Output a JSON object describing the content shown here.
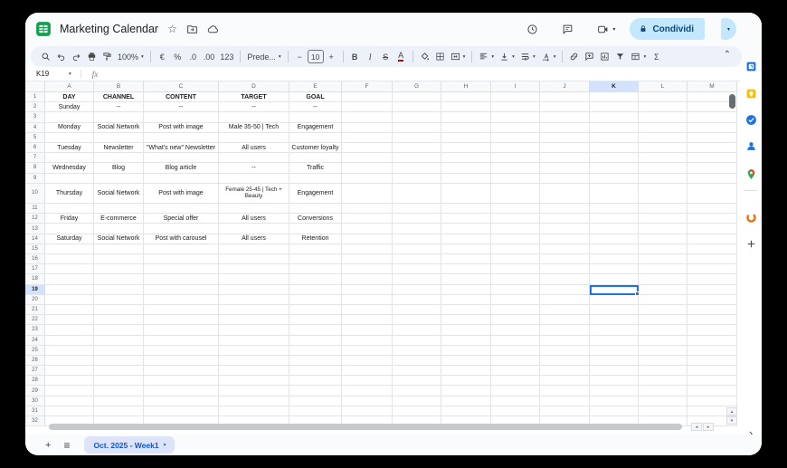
{
  "titlebar": {
    "title": "Marketing Calendar",
    "share_label": "Condividi",
    "icons": [
      "star-icon",
      "move-folder-icon",
      "cloud-status-icon",
      "history-icon",
      "comments-icon",
      "meet-icon",
      "lock-icon"
    ]
  },
  "toolbar": {
    "items": [
      {
        "name": "search",
        "type": "icon",
        "icon": "search"
      },
      {
        "name": "undo",
        "type": "icon",
        "icon": "undo"
      },
      {
        "name": "redo",
        "type": "icon",
        "icon": "redo"
      },
      {
        "name": "print",
        "type": "icon",
        "icon": "print"
      },
      {
        "name": "paint-format",
        "type": "icon",
        "icon": "paint"
      },
      {
        "name": "zoom",
        "type": "select",
        "label": "100%"
      },
      {
        "name": "sep1",
        "type": "sep"
      },
      {
        "name": "format-currency",
        "type": "text",
        "label": "€"
      },
      {
        "name": "format-percent",
        "type": "text",
        "label": "%"
      },
      {
        "name": "decrease-decimals",
        "type": "text",
        "label": ".0"
      },
      {
        "name": "increase-decimals",
        "type": "text",
        "label": ".00"
      },
      {
        "name": "more-formats",
        "type": "text",
        "label": "123"
      },
      {
        "name": "sep2",
        "type": "sep"
      },
      {
        "name": "font",
        "type": "select",
        "label": "Prede..."
      },
      {
        "name": "sep3",
        "type": "sep"
      },
      {
        "name": "font-size-decrease",
        "type": "text",
        "label": "−"
      },
      {
        "name": "font-size",
        "type": "input",
        "label": "10"
      },
      {
        "name": "font-size-increase",
        "type": "text",
        "label": "+"
      },
      {
        "name": "sep4",
        "type": "sep"
      },
      {
        "name": "bold",
        "type": "text",
        "label": "B",
        "cls": "b"
      },
      {
        "name": "italic",
        "type": "text",
        "label": "I",
        "cls": "i"
      },
      {
        "name": "strikethrough",
        "type": "text",
        "label": "S",
        "cls": "s"
      },
      {
        "name": "text-color",
        "type": "text",
        "label": "A",
        "cls": "u"
      },
      {
        "name": "sep5",
        "type": "sep"
      },
      {
        "name": "fill-color",
        "type": "icon",
        "icon": "fill"
      },
      {
        "name": "borders",
        "type": "icon",
        "icon": "borders"
      },
      {
        "name": "merge-cells",
        "type": "select-icon",
        "icon": "merge"
      },
      {
        "name": "sep6",
        "type": "sep"
      },
      {
        "name": "horizontal-align",
        "type": "select-icon",
        "icon": "halign"
      },
      {
        "name": "vertical-align",
        "type": "select-icon",
        "icon": "valign"
      },
      {
        "name": "text-wrap",
        "type": "select-icon",
        "icon": "wrap"
      },
      {
        "name": "text-rotate",
        "type": "select-icon",
        "icon": "rotate"
      },
      {
        "name": "sep7",
        "type": "sep"
      },
      {
        "name": "insert-link",
        "type": "icon",
        "icon": "link"
      },
      {
        "name": "insert-comment",
        "type": "icon",
        "icon": "comment"
      },
      {
        "name": "insert-chart",
        "type": "icon",
        "icon": "chart"
      },
      {
        "name": "create-filter",
        "type": "icon",
        "icon": "filter"
      },
      {
        "name": "table-views",
        "type": "select-icon",
        "icon": "views"
      },
      {
        "name": "functions",
        "type": "text",
        "label": "Σ"
      }
    ]
  },
  "formula_bar": {
    "cell_ref": "K19",
    "fx_label": "fx"
  },
  "sheet": {
    "columns": [
      "A",
      "B",
      "C",
      "D",
      "E",
      "F",
      "G",
      "H",
      "I",
      "J",
      "K",
      "L",
      "M"
    ],
    "row_count": 32,
    "selection": {
      "cell": "K19",
      "column": "K",
      "row": 19
    },
    "table": {
      "header_row": 1,
      "headers": [
        "DAY",
        "CHANNEL",
        "CONTENT",
        "TARGET",
        "GOAL"
      ],
      "rows": [
        {
          "row": 2,
          "cells": [
            "Sunday",
            "--",
            "--",
            "--",
            "--"
          ]
        },
        {
          "row": 4,
          "cells": [
            "Monday",
            "Social Network",
            "Post with image",
            "Male 35-50 | Tech",
            "Engagement"
          ]
        },
        {
          "row": 6,
          "cells": [
            "Tuesday",
            "Newsletter",
            "\"What's new\" Newsletter",
            "All users",
            "Customer loyalty"
          ]
        },
        {
          "row": 8,
          "cells": [
            "Wednesday",
            "Blog",
            "Blog article",
            "--",
            "Traffic"
          ]
        },
        {
          "row": 10,
          "cells": [
            "Thursday",
            "Social Network",
            "Post with image",
            "Female 25-45 | Tech + Beauty",
            "Engagement"
          ]
        },
        {
          "row": 12,
          "cells": [
            "Friday",
            "E-commerce",
            "Special offer",
            "All users",
            "Conversions"
          ]
        },
        {
          "row": 14,
          "cells": [
            "Saturday",
            "Social Network",
            "Post with carousel",
            "All users",
            "Retention"
          ]
        }
      ]
    }
  },
  "sidebar": {
    "icons": [
      {
        "name": "calendar"
      },
      {
        "name": "keep"
      },
      {
        "name": "tasks"
      },
      {
        "name": "contacts"
      },
      {
        "name": "maps"
      },
      {
        "name": "addon"
      },
      {
        "name": "get-addons"
      }
    ]
  },
  "bottombar": {
    "add_sheet": "+",
    "all_sheets": "≡",
    "tab_label": "Oct. 2025 - Week1"
  },
  "colors": {
    "accent": "#1a73e8",
    "selection_border": "#1a73e8",
    "column_highlight": "#d3e3fd",
    "share_button_bg": "#c2e7ff",
    "sheets_green": "#12a150",
    "tab_bg": "#dde3f9",
    "tab_text": "#0b57d0",
    "toolbar_bg": "#edf2fa",
    "topband_bg": "#f9fbfd"
  }
}
